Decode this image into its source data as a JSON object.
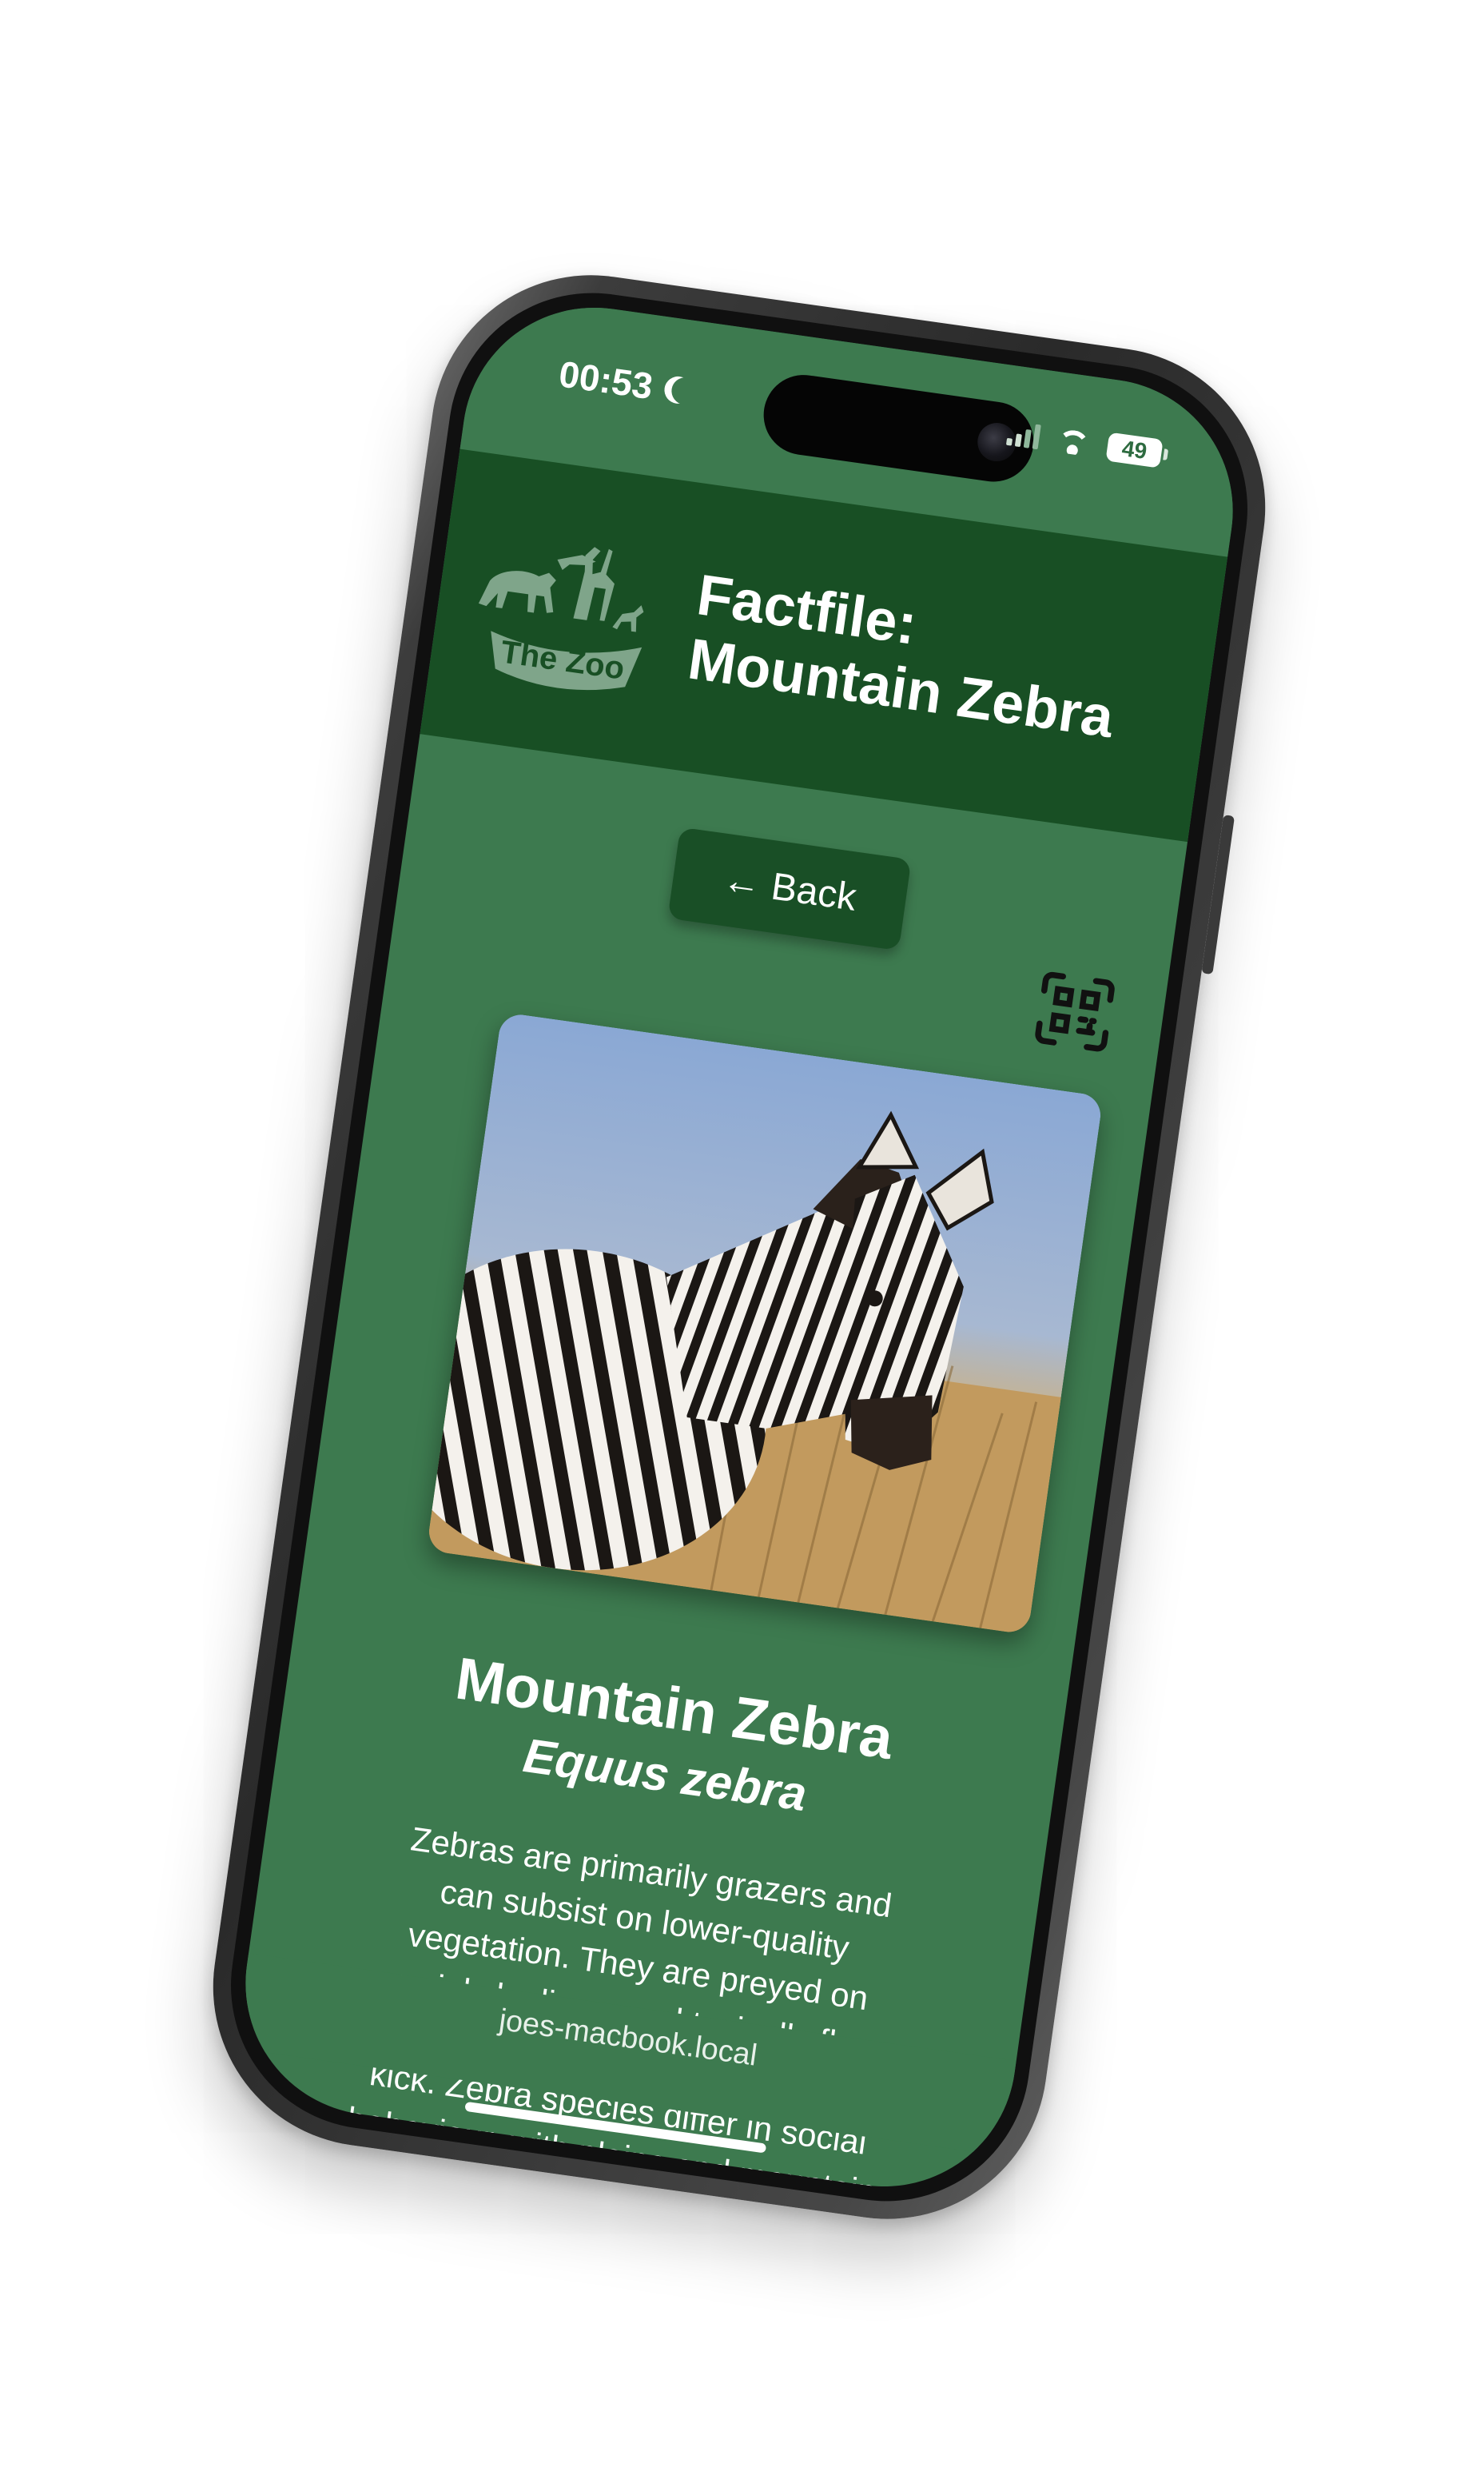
{
  "status_bar": {
    "time": "00:53",
    "battery": "49",
    "icons": [
      "moon-icon",
      "signal-icon",
      "wifi-icon",
      "battery-icon"
    ]
  },
  "header": {
    "logo_text": "The Zoo",
    "title": "Factfile: Mountain Zebra"
  },
  "nav": {
    "back_label": "← Back",
    "qr_icon": "qr-code-icon"
  },
  "animal": {
    "name": "Mountain Zebra",
    "species": "Equus zebra",
    "description": "Zebras are primarily grazers and can subsist on lower-quality vegetation. They are preyed on mainly by lions, and typically flee when threatened but also bite and kick. Zebra species differ in social behaviour, with plains and mountain zebra living in stable harems consisting of an"
  },
  "browser": {
    "url": "joes-macbook.local"
  },
  "colors": {
    "page_bg": "#3d7a4f",
    "header_bg": "#184f24",
    "button_bg": "#194f26",
    "text": "#ffffff"
  }
}
